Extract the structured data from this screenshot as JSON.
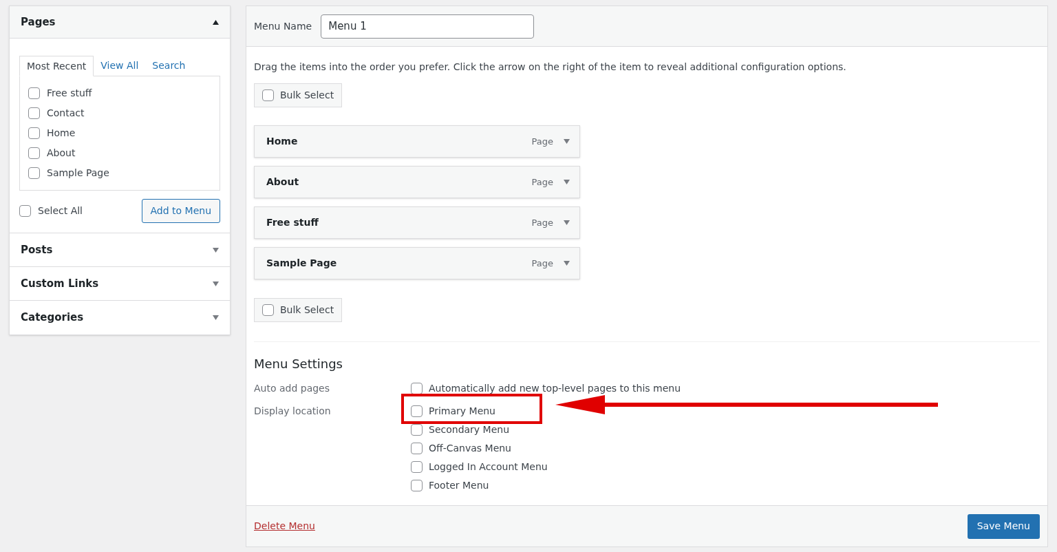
{
  "pages_box": {
    "title": "Pages",
    "expanded": true,
    "tabs": [
      {
        "label": "Most Recent",
        "selected": true
      },
      {
        "label": "View All",
        "selected": false
      },
      {
        "label": "Search",
        "selected": false
      }
    ],
    "items": [
      {
        "label": "Free stuff",
        "checked": false
      },
      {
        "label": "Contact",
        "checked": false
      },
      {
        "label": "Home",
        "checked": false
      },
      {
        "label": "About",
        "checked": false
      },
      {
        "label": "Sample Page",
        "checked": false
      }
    ],
    "select_all": {
      "label": "Select All",
      "checked": false
    },
    "add_button": "Add to Menu"
  },
  "other_boxes": [
    {
      "title": "Posts",
      "expanded": false
    },
    {
      "title": "Custom Links",
      "expanded": false
    },
    {
      "title": "Categories",
      "expanded": false
    }
  ],
  "menu_name": {
    "label": "Menu Name",
    "value": "Menu 1"
  },
  "instructions": "Drag the items into the order you prefer. Click the arrow on the right of the item to reveal additional configuration options.",
  "bulk_select_top": {
    "label": "Bulk Select",
    "checked": false
  },
  "menu_items": [
    {
      "title": "Home",
      "type": "Page"
    },
    {
      "title": "About",
      "type": "Page"
    },
    {
      "title": "Free stuff",
      "type": "Page"
    },
    {
      "title": "Sample Page",
      "type": "Page"
    }
  ],
  "bulk_select_bottom": {
    "label": "Bulk Select",
    "checked": false
  },
  "settings": {
    "heading": "Menu Settings",
    "auto_add": {
      "label": "Auto add pages",
      "option": {
        "label": "Automatically add new top-level pages to this menu",
        "checked": false
      }
    },
    "display_location": {
      "label": "Display location",
      "options": [
        {
          "label": "Primary Menu",
          "checked": false,
          "highlighted": true
        },
        {
          "label": "Secondary Menu",
          "checked": false,
          "highlighted": false
        },
        {
          "label": "Off-Canvas Menu",
          "checked": false,
          "highlighted": false
        },
        {
          "label": "Logged In Account Menu",
          "checked": false,
          "highlighted": false
        },
        {
          "label": "Footer Menu",
          "checked": false,
          "highlighted": false
        }
      ]
    }
  },
  "delete_link": "Delete Menu",
  "save_button": "Save Menu"
}
